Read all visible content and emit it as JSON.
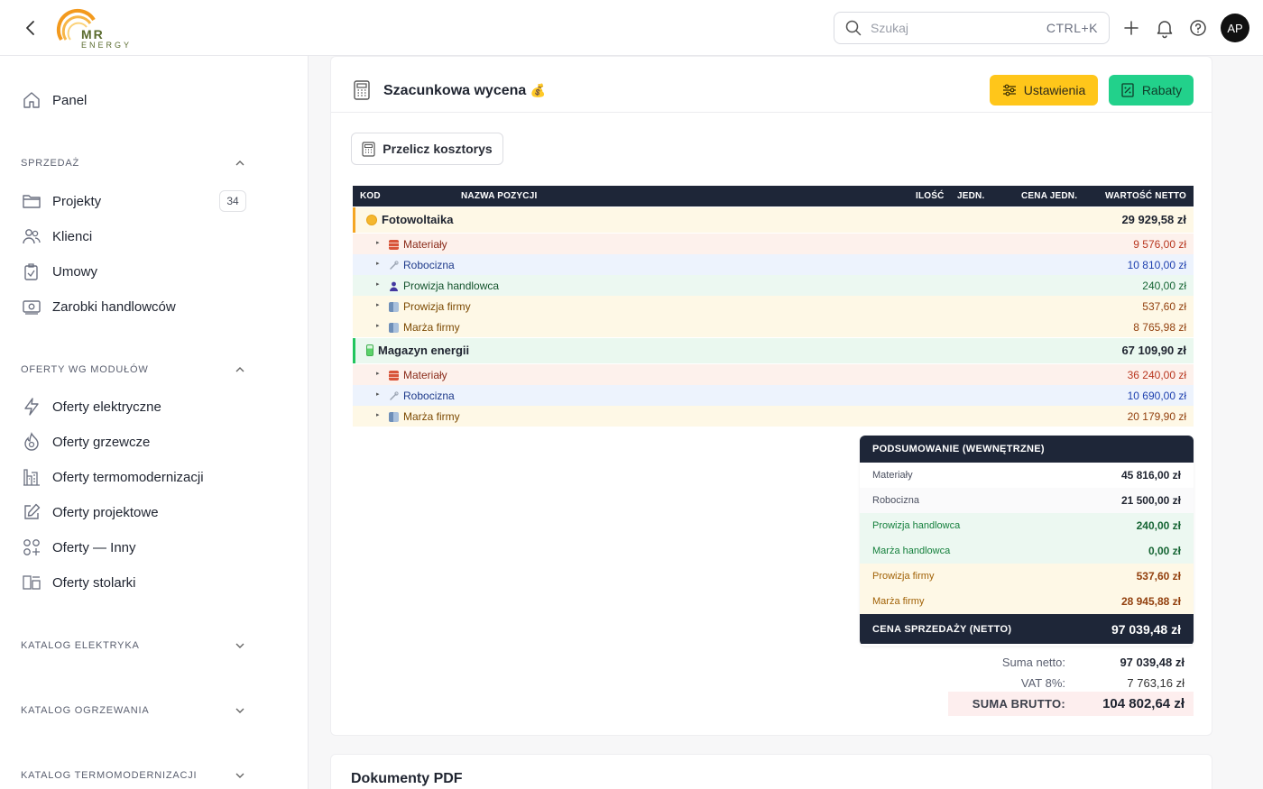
{
  "app": {
    "logo_mr": "MR",
    "logo_energy": "ENERGY",
    "avatar_initials": "AP"
  },
  "search": {
    "placeholder": "Szukaj",
    "shortcut": "CTRL+K"
  },
  "sidebar": {
    "panel": "Panel",
    "sections": {
      "sprzedaz": "SPRZEDAŻ",
      "oferty": "OFERTY WG MODUŁÓW",
      "katalog_elektryka": "KATALOG ELEKTRYKA",
      "katalog_ogrzewania": "KATALOG OGRZEWANIA",
      "katalog_termo": "KATALOG TERMOMODERNIZACJI"
    },
    "sales_items": [
      {
        "label": "Projekty",
        "icon": "folder-icon",
        "badge": "34"
      },
      {
        "label": "Klienci",
        "icon": "users-icon"
      },
      {
        "label": "Umowy",
        "icon": "contract-icon"
      },
      {
        "label": "Zarobki handlowców",
        "icon": "money-icon"
      }
    ],
    "offer_items": [
      {
        "label": "Oferty elektryczne",
        "icon": "lightning-icon"
      },
      {
        "label": "Oferty grzewcze",
        "icon": "flame-icon"
      },
      {
        "label": "Oferty termomodernizacji",
        "icon": "building-icon"
      },
      {
        "label": "Oferty projektowe",
        "icon": "edit-icon"
      },
      {
        "label": "Oferty — Inny",
        "icon": "grid-plus-icon"
      },
      {
        "label": "Oferty stolarki",
        "icon": "window-icon"
      }
    ]
  },
  "main": {
    "title": "Szacunkowa wycena",
    "title_emoji": "💰",
    "settings_label": "Ustawienia",
    "rabaty_label": "Rabaty",
    "recalc_label": "Przelicz kosztorys",
    "colors": {
      "settings": "#ffc61a",
      "rabaty": "#22d18b",
      "dark": "#1e2638"
    }
  },
  "table": {
    "headers": {
      "kod": "KOD",
      "nazwa": "NAZWA POZYCJI",
      "ilosc": "ILOŚĆ",
      "jedn": "JEDN.",
      "cena": "CENA JEDN.",
      "wartosc": "WARTOŚĆ NETTO"
    },
    "rows": [
      {
        "type": "group",
        "label": "Fotowoltaika",
        "icon": "sun-icon",
        "value": "29 929,58 zł"
      },
      {
        "type": "item",
        "label": "Materiały",
        "icon": "bricks-icon",
        "value": "9 576,00 zł"
      },
      {
        "type": "item",
        "label": "Robocizna",
        "icon": "wrench-icon",
        "value": "10 810,00 zł"
      },
      {
        "type": "item",
        "label": "Prowizja handlowca",
        "icon": "person-icon",
        "value": "240,00 zł"
      },
      {
        "type": "item",
        "label": "Prowizja firmy",
        "icon": "office-icon",
        "value": "537,60 zł"
      },
      {
        "type": "item",
        "label": "Marża firmy",
        "icon": "office-icon",
        "value": "8 765,98 zł"
      },
      {
        "type": "group",
        "label": "Magazyn energii",
        "icon": "battery-icon",
        "value": "67 109,90 zł"
      },
      {
        "type": "item",
        "label": "Materiały",
        "icon": "bricks-icon",
        "value": "36 240,00 zł"
      },
      {
        "type": "item",
        "label": "Robocizna",
        "icon": "wrench-icon",
        "value": "10 690,00 zł"
      },
      {
        "type": "item",
        "label": "Marża firmy",
        "icon": "office-icon",
        "value": "20 179,90 zł"
      }
    ]
  },
  "summary": {
    "title": "PODSUMOWANIE (WEWNĘTRZNE)",
    "rows": [
      {
        "label": "Materiały",
        "value": "45 816,00 zł"
      },
      {
        "label": "Robocizna",
        "value": "21 500,00 zł"
      },
      {
        "label": "Prowizja handlowca",
        "value": "240,00 zł"
      },
      {
        "label": "Marża handlowca",
        "value": "0,00 zł"
      },
      {
        "label": "Prowizja firmy",
        "value": "537,60 zł"
      },
      {
        "label": "Marża firmy",
        "value": "28 945,88 zł"
      }
    ],
    "sale_label": "CENA SPRZEDAŻY (NETTO)",
    "sale_value": "97 039,48 zł"
  },
  "totals": {
    "netto_label": "Suma netto:",
    "netto_value": "97 039,48 zł",
    "vat_label": "VAT 8%:",
    "vat_value": "7 763,16 zł",
    "brutto_label": "SUMA BRUTTO:",
    "brutto_value": "104 802,64 zł"
  },
  "documents": {
    "title": "Dokumenty PDF"
  }
}
